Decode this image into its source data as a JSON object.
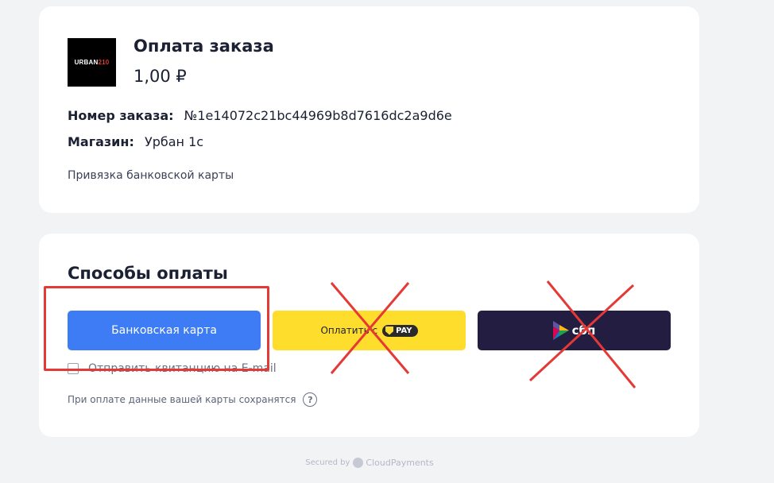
{
  "order": {
    "logo_text": "URBAN",
    "logo_accent": "210",
    "title": "Оплата заказа",
    "amount": "1,00 ₽",
    "order_label": "Номер заказа:",
    "order_number": "№1e14072c21bc44969b8d7616dc2a9d6e",
    "shop_label": "Магазин:",
    "shop_name": "Урбан 1с",
    "note": "Привязка банковской карты"
  },
  "payment": {
    "title": "Способы оплаты",
    "card_button": "Банковская карта",
    "tpay_button": "Оплатить с",
    "tpay_badge": "PAY",
    "sbp_button": "сбп",
    "receipt_label": "Отправить квитанцию на E-mail",
    "save_note": "При оплате данные вашей карты сохранятся",
    "help_icon": "?"
  },
  "footer": {
    "secured_by": "Secured by",
    "brand": "CloudPayments"
  },
  "colors": {
    "card_button": "#3d7cf4",
    "tpay_button": "#ffdd2d",
    "sbp_button": "#231d42",
    "annotation": "#e53935"
  }
}
